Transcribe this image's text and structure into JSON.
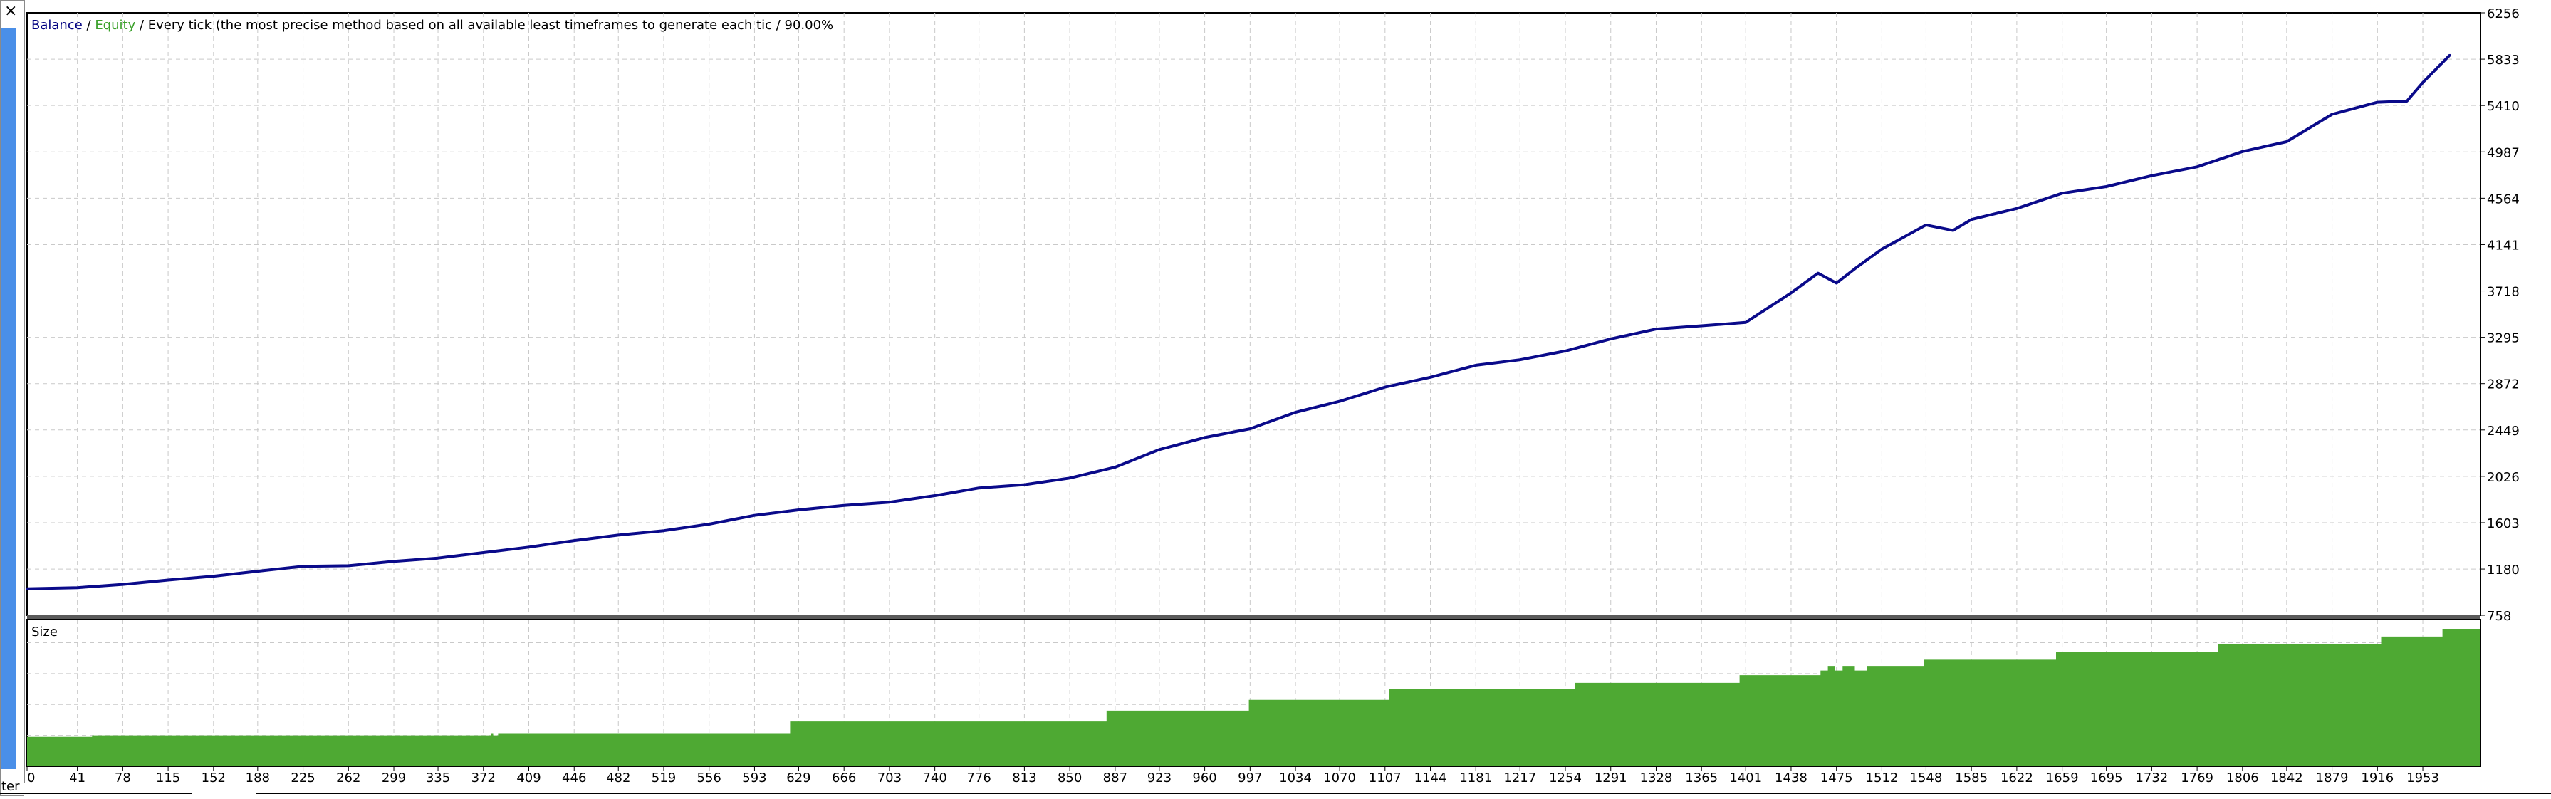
{
  "window": {
    "close_glyph": "×",
    "side_caption": "ter"
  },
  "legend": {
    "balance": "Balance",
    "sep1": " / ",
    "equity": "Equity",
    "rest": " / Every tick (the most precise method based on all available least timeframes to generate each tic / 90.00%",
    "balance_color": "#000080",
    "equity_color": "#3aa02a"
  },
  "lower_panel": {
    "title": "Size"
  },
  "colors": {
    "balance_line": "#0a0a8a",
    "size_fill": "#4ea933",
    "grid": "#c9c9c9",
    "side_bar": "#4a8fe8"
  },
  "chart_data": [
    {
      "type": "line",
      "series": [
        {
          "name": "Balance",
          "x": [
            0,
            41,
            78,
            115,
            152,
            188,
            225,
            262,
            299,
            335,
            372,
            409,
            446,
            482,
            519,
            556,
            593,
            629,
            666,
            703,
            740,
            776,
            813,
            850,
            887,
            923,
            960,
            997,
            1034,
            1070,
            1107,
            1144,
            1181,
            1217,
            1254,
            1291,
            1328,
            1365,
            1401,
            1438,
            1460,
            1475,
            1490,
            1512,
            1548,
            1570,
            1585,
            1622,
            1659,
            1695,
            1732,
            1769,
            1806,
            1842,
            1879,
            1916,
            1940,
            1953,
            1975
          ],
          "values": [
            1000,
            1010,
            1040,
            1080,
            1115,
            1160,
            1205,
            1210,
            1250,
            1280,
            1330,
            1380,
            1440,
            1490,
            1530,
            1590,
            1670,
            1720,
            1760,
            1790,
            1850,
            1920,
            1950,
            2010,
            2110,
            2270,
            2380,
            2460,
            2610,
            2710,
            2840,
            2930,
            3040,
            3090,
            3170,
            3280,
            3370,
            3400,
            3430,
            3700,
            3880,
            3790,
            3920,
            4100,
            4320,
            4270,
            4370,
            4470,
            4610,
            4670,
            4770,
            4850,
            4990,
            5080,
            5330,
            5440,
            5450,
            5620,
            5870
          ]
        }
      ],
      "ylim": [
        758,
        6256
      ],
      "y_ticks": [
        "6256",
        "5833",
        "5410",
        "4987",
        "4564",
        "4141",
        "3718",
        "3295",
        "2872",
        "2449",
        "2026",
        "1603",
        "1180",
        "758"
      ],
      "grid": true
    },
    {
      "type": "area",
      "series": [
        {
          "name": "Size",
          "steps": [
            [
              0,
              0.38
            ],
            [
              53,
              0.4
            ],
            [
              378,
              0.42
            ],
            [
              380,
              0.4
            ],
            [
              384,
              0.42
            ],
            [
              622,
              0.58
            ],
            [
              880,
              0.72
            ],
            [
              996,
              0.86
            ],
            [
              1110,
              1.0
            ],
            [
              1262,
              1.08
            ],
            [
              1396,
              1.18
            ],
            [
              1462,
              1.24
            ],
            [
              1468,
              1.3
            ],
            [
              1474,
              1.24
            ],
            [
              1480,
              1.3
            ],
            [
              1490,
              1.24
            ],
            [
              1500,
              1.3
            ],
            [
              1546,
              1.38
            ],
            [
              1654,
              1.48
            ],
            [
              1786,
              1.58
            ],
            [
              1919,
              1.68
            ],
            [
              1969,
              1.78
            ],
            [
              2000,
              1.78
            ]
          ]
        }
      ],
      "ylim": [
        0,
        1.9
      ],
      "grid": true
    }
  ],
  "x_axis": {
    "ticks": [
      "0",
      "41",
      "78",
      "115",
      "152",
      "188",
      "225",
      "262",
      "299",
      "335",
      "372",
      "409",
      "446",
      "482",
      "519",
      "556",
      "593",
      "629",
      "666",
      "703",
      "740",
      "776",
      "813",
      "850",
      "887",
      "923",
      "960",
      "997",
      "1034",
      "1070",
      "1107",
      "1144",
      "1181",
      "1217",
      "1254",
      "1291",
      "1328",
      "1365",
      "1401",
      "1438",
      "1475",
      "1512",
      "1548",
      "1585",
      "1622",
      "1659",
      "1695",
      "1732",
      "1769",
      "1806",
      "1842",
      "1879",
      "1916",
      "1953"
    ],
    "xlim": [
      0,
      2000
    ]
  }
}
